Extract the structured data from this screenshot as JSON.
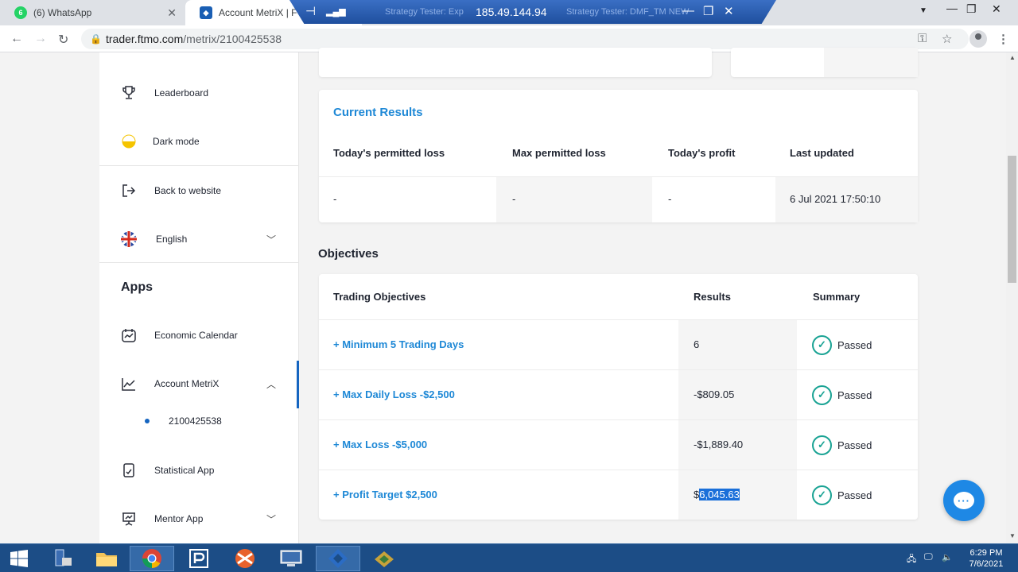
{
  "browser": {
    "tabs": [
      {
        "label": "(6) WhatsApp",
        "badge": "6"
      },
      {
        "label": "Account MetriX | FTMO"
      }
    ],
    "rdp_host": "185.49.144.94",
    "rdp_bg_tabs": [
      "Strategy Tester: Exp",
      "Strategy Tester: DMF_TM NEW"
    ],
    "url_host": "trader.ftmo.com",
    "url_path": "/metrix/2100425538"
  },
  "sidebar": {
    "leaderboard": "Leaderboard",
    "dark_mode": "Dark mode",
    "back_to_website": "Back to website",
    "language": "English",
    "apps_heading": "Apps",
    "economic_calendar": "Economic Calendar",
    "account_metrix": "Account MetriX",
    "account_number": "2100425538",
    "statistical_app": "Statistical App",
    "mentor_app": "Mentor App"
  },
  "current_results": {
    "title": "Current Results",
    "headers": [
      "Today's permitted loss",
      "Max permitted loss",
      "Today's profit",
      "Last updated"
    ],
    "values": [
      "-",
      "-",
      "-",
      "6 Jul 2021 17:50:10"
    ]
  },
  "objectives": {
    "title": "Objectives",
    "headers": {
      "objective": "Trading Objectives",
      "results": "Results",
      "summary": "Summary"
    },
    "rows": [
      {
        "name": "+ Minimum 5 Trading Days",
        "result": "6",
        "summary": "Passed"
      },
      {
        "name": "+ Max Daily Loss -$2,500",
        "result": "-$809.05",
        "summary": "Passed"
      },
      {
        "name": "+ Max Loss -$5,000",
        "result": "-$1,889.40",
        "summary": "Passed"
      },
      {
        "name": "+ Profit Target $2,500",
        "result_prefix": "$",
        "result_selected": "6,045.63",
        "summary": "Passed"
      }
    ]
  },
  "taskbar": {
    "time": "6:29 PM",
    "date": "7/6/2021"
  },
  "colors": {
    "accent": "#1e88d6",
    "check": "#1aa394",
    "taskbar": "#1c4d86",
    "selection": "#1a6fd9"
  }
}
